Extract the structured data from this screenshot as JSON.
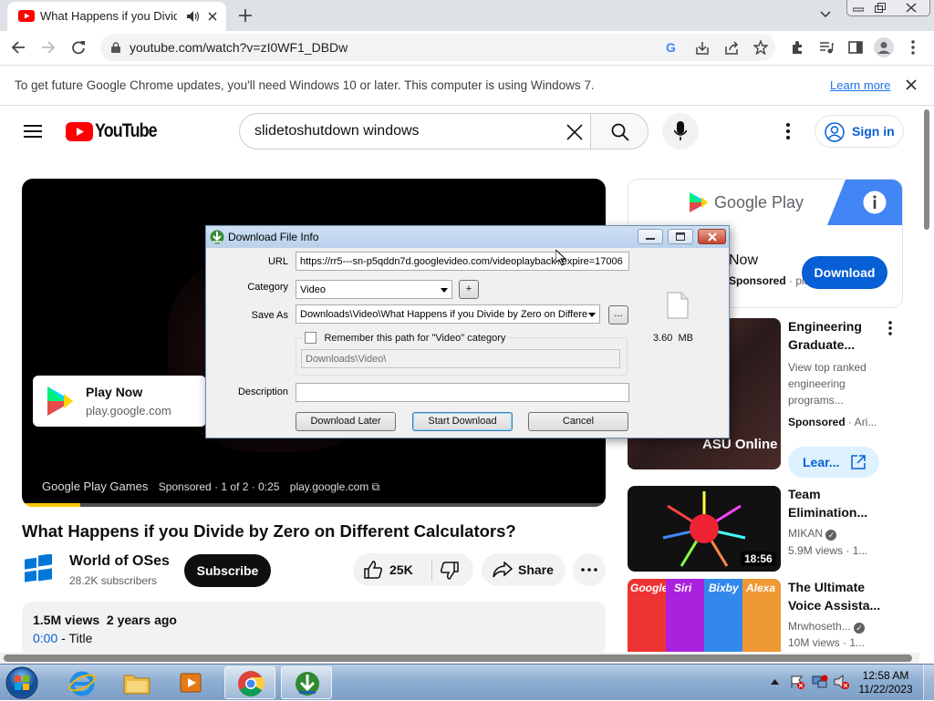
{
  "browser": {
    "tab_title": "What Happens if you Divide",
    "url": "youtube.com/watch?v=zI0WF1_DBDw",
    "infobar_message": "To get future Google Chrome updates, you'll need Windows 10 or later. This computer is using Windows 7.",
    "infobar_link": "Learn more"
  },
  "youtube": {
    "logo_text": "YouTube",
    "search_query": "slidetoshutdown windows",
    "sign_in": "Sign in",
    "player": {
      "ad_card_title": "Play Now",
      "ad_card_domain": "play.google.com",
      "ad_footer_brand": "Google Play Games",
      "ad_footer_counter": "Sponsored · 1 of 2 · 0:25",
      "ad_footer_domain": "play.google.com",
      "progress": 0.1,
      "progress_color": "#fdc600"
    },
    "video": {
      "title": "What Happens if you Divide by Zero on Different Calculators?",
      "channel": "World of OSes",
      "subscribers": "28.2K subscribers",
      "subscribe": "Subscribe",
      "likes": "25K",
      "share": "Share",
      "views_age": "1.5M views  2 years ago",
      "chapter_time": "0:00",
      "chapter_title": " - Title"
    },
    "right_ad": {
      "brand": "Google Play",
      "now": "Now",
      "sponsored": "Sponsored",
      "domain": "play.g",
      "download": "Download"
    },
    "recs": [
      {
        "title": "Engineering Graduate...",
        "channel": "View top ranked engineering programs...",
        "meta": "Sponsored",
        "meta2": "· Ari...",
        "cta": "Lear...",
        "overlay": "ASU Online"
      },
      {
        "title": "Team Elimination...",
        "channel": "MIKAN",
        "meta": "5.9M views",
        "meta2": "· 1...",
        "duration": "18:56"
      },
      {
        "title": "The Ultimate Voice Assista...",
        "channel": "Mrwhoseth...",
        "meta": "10M views",
        "meta2": "· 1...",
        "labels": [
          "Google",
          "Siri",
          "Bixby",
          "Alexa"
        ]
      }
    ]
  },
  "dialog": {
    "title": "Download File Info",
    "url_label": "URL",
    "url_value": "https://rr5---sn-p5qddn7d.googlevideo.com/videoplayback?expire=17006",
    "category_label": "Category",
    "category_value": "Video",
    "save_as_label": "Save As",
    "save_as_value": "Downloads\\Video\\What Happens if you Divide by Zero on Differe",
    "browse": "...",
    "remember_label": "Remember this path for \"Video\" category",
    "remember_path": "Downloads\\Video\\",
    "description_label": "Description",
    "size": "3.60  MB",
    "btn_later": "Download Later",
    "btn_start": "Start Download",
    "btn_cancel": "Cancel"
  },
  "taskbar": {
    "time": "12:58 AM",
    "date": "11/22/2023"
  }
}
